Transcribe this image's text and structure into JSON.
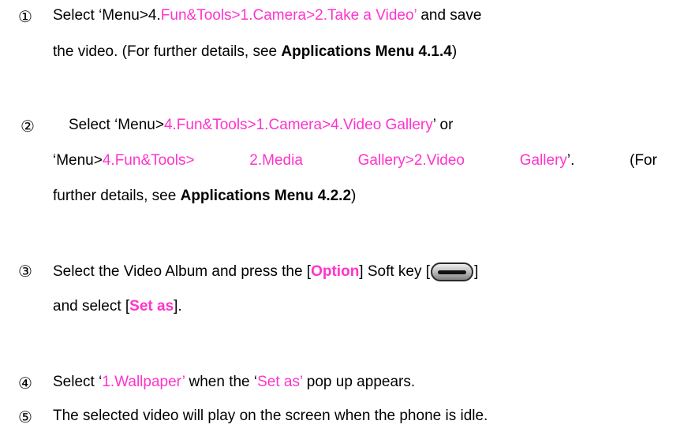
{
  "steps": [
    {
      "marker": "①",
      "line1": {
        "a": "Select ‘Menu>4.",
        "b": "Fun&Tools>1.Camera>2.Take a Video’",
        "c": " and save"
      },
      "line2": {
        "a": "the video. (For further details, see ",
        "b": "Applications Menu 4.1.4",
        "c": ")"
      }
    },
    {
      "marker": "②",
      "line1": {
        "a": "Select ‘Menu>",
        "b": "4.Fun&Tools>1.Camera>4.Video Gallery",
        "c": "’ or"
      },
      "line2": {
        "a": "‘Menu>",
        "b1": "4.Fun&Tools>",
        "b2": "2.Media",
        "b3": "Gallery>2.Video",
        "b4": "Gallery",
        "c1": "’.",
        "c2": "(For"
      },
      "line3": {
        "a": "further details, see ",
        "b": "Applications Menu 4.2.2",
        "c": ")"
      }
    },
    {
      "marker": "③",
      "line1": {
        "a": "Select the Video Album and press the [",
        "b": "Option",
        "c": "] Soft key [",
        "d": "]"
      },
      "line2": {
        "a": "and select [",
        "b": "Set as",
        "c": "]."
      },
      "softkey_icon": "soft-key-button-icon"
    },
    {
      "marker": "④",
      "line1": {
        "a": "Select ‘",
        "b": "1.Wallpaper’",
        "c": " when the ‘",
        "d": "Set as’",
        "e": " pop up appears."
      }
    },
    {
      "marker": "⑤",
      "line1": {
        "a": "The selected video will play on the screen when the phone is idle."
      }
    }
  ],
  "colors": {
    "highlight": "#ff33cc",
    "text": "#000000"
  }
}
